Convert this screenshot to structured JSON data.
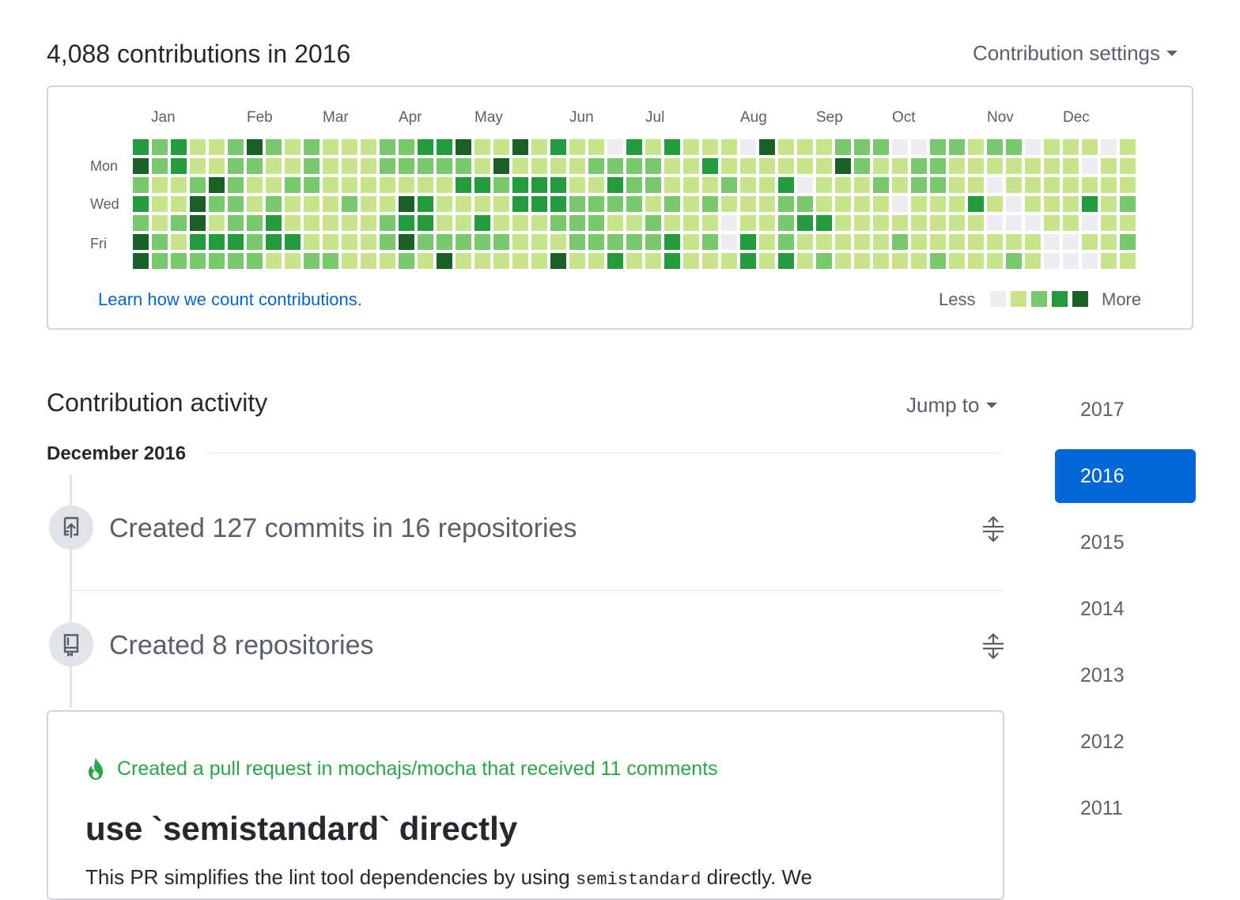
{
  "header": {
    "title": "4,088 contributions in 2016",
    "settings_label": "Contribution settings"
  },
  "graph": {
    "months": [
      "Jan",
      "Feb",
      "Mar",
      "Apr",
      "May",
      "Jun",
      "Jul",
      "Aug",
      "Sep",
      "Oct",
      "Nov",
      "Dec"
    ],
    "weekday_labels": [
      "Mon",
      "Wed",
      "Fri"
    ],
    "learn_link": "Learn how we count contributions.",
    "legend_less": "Less",
    "legend_more": "More",
    "level_colors": [
      "#ebedf0",
      "#c6e48b",
      "#7bc96f",
      "#239a3b",
      "#196127"
    ],
    "weeks": [
      [
        3,
        4,
        2,
        3,
        2,
        4,
        4
      ],
      [
        2,
        2,
        1,
        1,
        1,
        2,
        2
      ],
      [
        3,
        3,
        1,
        1,
        2,
        1,
        2
      ],
      [
        1,
        1,
        2,
        4,
        4,
        3,
        2
      ],
      [
        1,
        1,
        4,
        2,
        1,
        3,
        2
      ],
      [
        2,
        2,
        2,
        2,
        2,
        3,
        2
      ],
      [
        4,
        2,
        1,
        1,
        2,
        2,
        2
      ],
      [
        2,
        1,
        1,
        2,
        3,
        3,
        1
      ],
      [
        1,
        1,
        2,
        1,
        1,
        3,
        1
      ],
      [
        2,
        2,
        2,
        1,
        1,
        1,
        2
      ],
      [
        1,
        1,
        1,
        1,
        1,
        1,
        2
      ],
      [
        1,
        1,
        1,
        2,
        1,
        1,
        1
      ],
      [
        1,
        1,
        1,
        1,
        1,
        1,
        1
      ],
      [
        2,
        2,
        1,
        1,
        2,
        2,
        1
      ],
      [
        2,
        2,
        1,
        4,
        3,
        4,
        2
      ],
      [
        3,
        2,
        1,
        3,
        3,
        2,
        1
      ],
      [
        3,
        2,
        1,
        1,
        1,
        2,
        4
      ],
      [
        4,
        2,
        3,
        1,
        1,
        2,
        1
      ],
      [
        1,
        1,
        3,
        1,
        3,
        2,
        1
      ],
      [
        1,
        4,
        2,
        1,
        1,
        2,
        1
      ],
      [
        4,
        1,
        3,
        3,
        1,
        1,
        1
      ],
      [
        1,
        1,
        3,
        3,
        1,
        1,
        1
      ],
      [
        3,
        1,
        3,
        3,
        2,
        1,
        4
      ],
      [
        1,
        1,
        1,
        2,
        2,
        2,
        1
      ],
      [
        1,
        2,
        1,
        2,
        2,
        2,
        1
      ],
      [
        0,
        2,
        3,
        2,
        1,
        2,
        3
      ],
      [
        3,
        2,
        2,
        2,
        1,
        2,
        1
      ],
      [
        1,
        2,
        2,
        1,
        2,
        2,
        1
      ],
      [
        3,
        1,
        1,
        2,
        1,
        3,
        3
      ],
      [
        1,
        1,
        1,
        1,
        1,
        1,
        1
      ],
      [
        1,
        3,
        1,
        2,
        1,
        2,
        1
      ],
      [
        1,
        1,
        2,
        1,
        0,
        0,
        1
      ],
      [
        0,
        1,
        1,
        1,
        1,
        3,
        3
      ],
      [
        4,
        1,
        1,
        1,
        1,
        1,
        1
      ],
      [
        1,
        1,
        3,
        2,
        2,
        2,
        3
      ],
      [
        1,
        1,
        0,
        2,
        3,
        1,
        1
      ],
      [
        1,
        1,
        1,
        1,
        3,
        1,
        2
      ],
      [
        2,
        4,
        1,
        1,
        1,
        1,
        1
      ],
      [
        2,
        2,
        1,
        1,
        1,
        1,
        1
      ],
      [
        2,
        1,
        2,
        1,
        1,
        1,
        1
      ],
      [
        0,
        1,
        1,
        0,
        1,
        2,
        1
      ],
      [
        0,
        2,
        2,
        1,
        1,
        1,
        1
      ],
      [
        2,
        2,
        2,
        1,
        1,
        1,
        2
      ],
      [
        2,
        1,
        1,
        1,
        1,
        1,
        1
      ],
      [
        1,
        1,
        1,
        3,
        1,
        1,
        1
      ],
      [
        2,
        1,
        0,
        1,
        0,
        1,
        1
      ],
      [
        2,
        1,
        1,
        0,
        0,
        1,
        2
      ],
      [
        0,
        1,
        1,
        1,
        0,
        1,
        1
      ],
      [
        1,
        1,
        1,
        1,
        1,
        0,
        0
      ],
      [
        1,
        1,
        1,
        1,
        1,
        0,
        0
      ],
      [
        1,
        0,
        1,
        3,
        0,
        1,
        0
      ],
      [
        0,
        1,
        1,
        1,
        1,
        1,
        1
      ],
      [
        1,
        1,
        1,
        2,
        1,
        2,
        1
      ]
    ]
  },
  "activity": {
    "title": "Contribution activity",
    "jump_label": "Jump to",
    "month_heading": "December 2016",
    "items": [
      {
        "text": "Created 127 commits in 16 repositories",
        "icon": "repo-push-icon"
      },
      {
        "text": "Created 8 repositories",
        "icon": "repo-icon"
      }
    ],
    "pull_request": {
      "note": "Created a pull request in mochajs/mocha that received 11 comments",
      "title": "use `semistandard` directly",
      "body_before": "This PR simplifies the lint tool dependencies by using ",
      "body_code": "semistandard",
      "body_after": " directly. We"
    }
  },
  "years": {
    "items": [
      "2017",
      "2016",
      "2015",
      "2014",
      "2013",
      "2012",
      "2011"
    ],
    "selected": "2016"
  }
}
